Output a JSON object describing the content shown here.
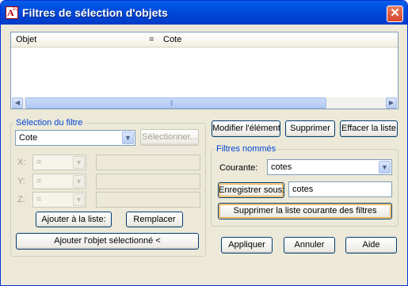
{
  "window": {
    "title": "Filtres de sélection d'objets",
    "close_glyph": "✕",
    "app_icon": "autocad-icon",
    "app_letter": "A",
    "app_sub": "10"
  },
  "list": {
    "columns": [
      "Objet",
      "=",
      "Cote"
    ],
    "scroll_grip": "|||"
  },
  "selection_filter": {
    "legend": "Sélection du filtre",
    "type_value": "Cote",
    "select_button": "Sélectionner...",
    "rows": [
      {
        "label": "X:",
        "op": "="
      },
      {
        "label": "Y:",
        "op": "="
      },
      {
        "label": "Z:",
        "op": "="
      }
    ],
    "add_to_list_button": "Ajouter à la liste:",
    "replace_button": "Remplacer",
    "add_selected_button": "Ajouter l'objet sélectionné <"
  },
  "list_buttons": {
    "modify": "Modifier l'élément",
    "delete": "Supprimer",
    "clear": "Effacer la liste"
  },
  "named_filters": {
    "legend": "Filtres nommés",
    "current_label": "Courante:",
    "current_value": "cotes",
    "save_as_button": "Enregistrer sous:",
    "save_as_value": "cotes",
    "delete_current_button": "Supprimer la liste courante des filtres"
  },
  "footer": {
    "apply": "Appliquer",
    "cancel": "Annuler",
    "help": "Aide"
  }
}
